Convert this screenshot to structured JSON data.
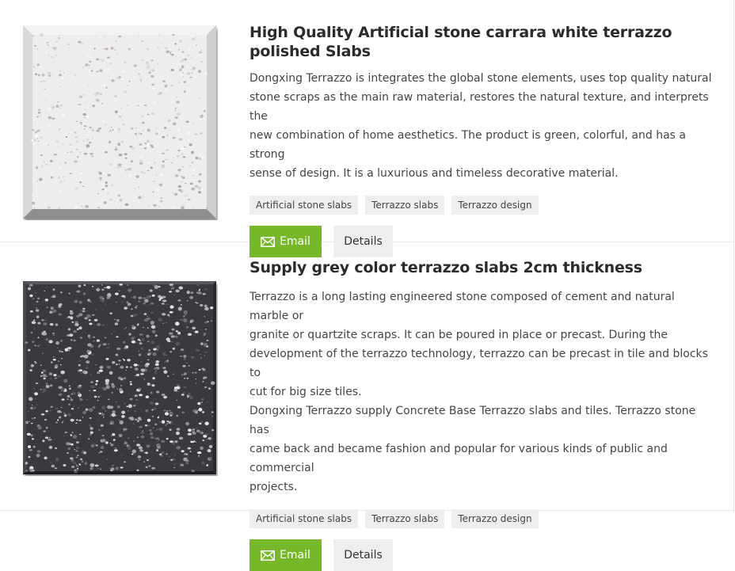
{
  "products": [
    {
      "title": "High Quality Artificial stone carrara white terrazzo polished Slabs",
      "image": "white-terrazzo-slab",
      "description": [
        "Dongxing Terrazzo is integrates the global stone elements, uses top quality natural",
        "stone scraps as the main raw material, restores the natural texture, and interprets the",
        "new combination of home aesthetics. The product is green, colorful, and has a strong",
        "sense of design. It is a luxurious and timeless decorative material."
      ],
      "tags": [
        "Artificial stone slabs",
        "Terrazzo slabs",
        "Terrazzo design"
      ],
      "email_label": "Email",
      "details_label": "Details"
    },
    {
      "title": "Supply grey color terrazzo slabs 2cm thickness",
      "image": "grey-terrazzo-slab",
      "description": [
        "Terrazzo is a long lasting engineered stone composed of cement and natural marble or",
        "granite or quartzite scraps. It can be poured in place or precast. During the",
        "development of the terrazzo technology, terrazzo can be precast in tile and blocks to",
        "cut for big size tiles.",
        "Dongxing Terrazzo supply Concrete Base Terrazzo slabs and tiles. Terrazzo stone has",
        "came back and became fashion and popular for various kinds of public and commercial",
        "projects."
      ],
      "tags": [
        "Artificial stone slabs",
        "Terrazzo slabs",
        "Terrazzo design"
      ],
      "email_label": "Email",
      "details_label": "Details"
    }
  ],
  "colors": {
    "email_button": "#76b82a",
    "details_button": "#eeeeee",
    "tag_background": "#eeeeee"
  },
  "icons": {
    "email": "envelope-icon"
  }
}
